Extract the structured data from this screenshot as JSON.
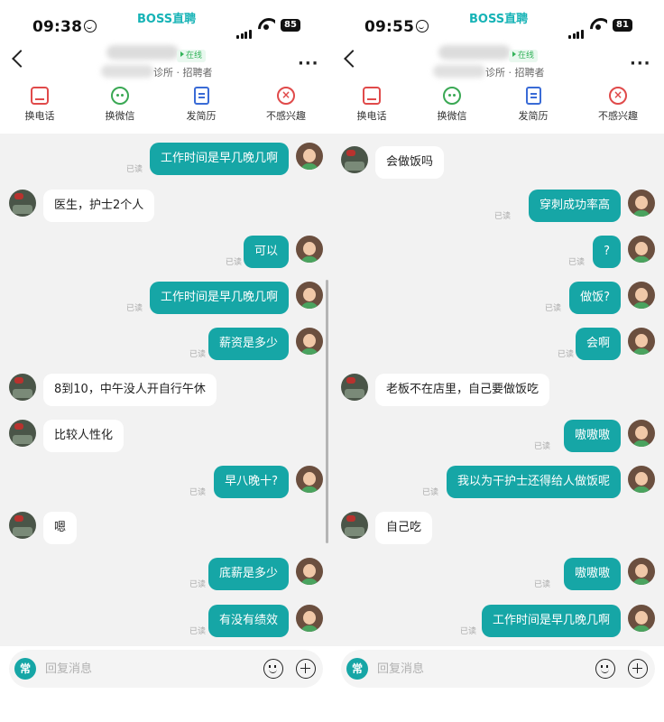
{
  "left": {
    "status": {
      "time": "09:38",
      "brand": "BOSS直聘",
      "battery": "85"
    },
    "header": {
      "online": "在线",
      "subtitle": "诊所 · 招聘者"
    },
    "actions": [
      "换电话",
      "换微信",
      "发简历",
      "不感兴趣"
    ],
    "read_label": "已读",
    "messages": [
      {
        "from": "me",
        "text": "工作时间是早几晚几啊",
        "read": true
      },
      {
        "from": "them",
        "text": "医生，护士2个人"
      },
      {
        "from": "me",
        "text": "可以",
        "read": true
      },
      {
        "from": "me",
        "text": "工作时间是早几晚几啊",
        "read": true
      },
      {
        "from": "me",
        "text": "薪资是多少",
        "read": true
      },
      {
        "from": "them",
        "text": "8到10，中午没人开自行午休"
      },
      {
        "from": "them",
        "text": "比较人性化"
      },
      {
        "from": "me",
        "text": "早八晚十?",
        "read": true
      },
      {
        "from": "them",
        "text": "嗯"
      },
      {
        "from": "me",
        "text": "底薪是多少",
        "read": true
      },
      {
        "from": "me",
        "text": "有没有绩效",
        "read": true
      }
    ],
    "input": {
      "common": "常",
      "placeholder": "回复消息"
    }
  },
  "right": {
    "status": {
      "time": "09:55",
      "brand": "BOSS直聘",
      "battery": "81"
    },
    "header": {
      "online": "在线",
      "subtitle": "诊所 · 招聘者"
    },
    "actions": [
      "换电话",
      "换微信",
      "发简历",
      "不感兴趣"
    ],
    "read_label": "已读",
    "messages": [
      {
        "from": "them",
        "text": "会做饭吗"
      },
      {
        "from": "me",
        "text": "穿刺成功率高",
        "read": true
      },
      {
        "from": "me",
        "text": "?",
        "read": true
      },
      {
        "from": "me",
        "text": "做饭?",
        "read": true
      },
      {
        "from": "me",
        "text": "会啊",
        "read": true
      },
      {
        "from": "them",
        "text": "老板不在店里，自己要做饭吃"
      },
      {
        "from": "me",
        "text": "嗷嗷嗷",
        "read": true
      },
      {
        "from": "me",
        "text": "我以为干护士还得给人做饭呢",
        "read": true
      },
      {
        "from": "them",
        "text": "自己吃"
      },
      {
        "from": "me",
        "text": "嗷嗷嗷",
        "read": true
      },
      {
        "from": "me",
        "text": "工作时间是早几晚几啊",
        "read": true
      }
    ],
    "input": {
      "common": "常",
      "placeholder": "回复消息"
    }
  },
  "colors": {
    "accent": "#16a6a6",
    "brand": "#16b3b6",
    "online": "#33b35a",
    "danger": "#e04a4a"
  }
}
